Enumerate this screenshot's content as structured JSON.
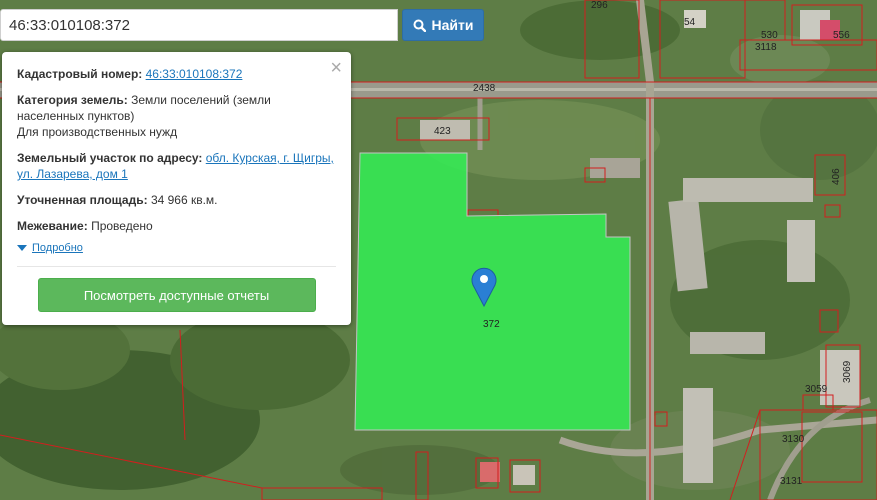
{
  "search": {
    "value": "46:33:010108:372",
    "button_label": "Найти"
  },
  "popup": {
    "cadastral_label": "Кадастровый номер:",
    "cadastral_value": "46:33:010108:372",
    "category_label": "Категория земель:",
    "category_value": "Земли поселений (земли населенных пунктов)",
    "usage": "Для производственных нужд",
    "address_label": "Земельный участок по адресу:",
    "address_value": "обл. Курская, г. Щигры, ул. Лазарева, дом 1",
    "area_label": "Уточненная площадь:",
    "area_value": "34 966 кв.м.",
    "survey_label": "Межевание:",
    "survey_value": "Проведено",
    "details_link": "Подробно",
    "reports_button": "Посмотреть доступные отчеты",
    "close_symbol": "×"
  },
  "map": {
    "parcel_labels": [
      "296",
      "54",
      "530",
      "3118",
      "556",
      "2438",
      "423",
      "406",
      "372",
      "3059",
      "3069",
      "3130",
      "3131"
    ],
    "colors": {
      "selected_parcel": "#33ee55",
      "parcel_border": "#d21e1e",
      "marker": "#2a7fd4",
      "search_button": "#337ab7",
      "reports_button": "#5cb85c"
    },
    "icons": [
      "search-icon",
      "map-marker-icon",
      "close-icon",
      "caret-down-icon"
    ]
  }
}
